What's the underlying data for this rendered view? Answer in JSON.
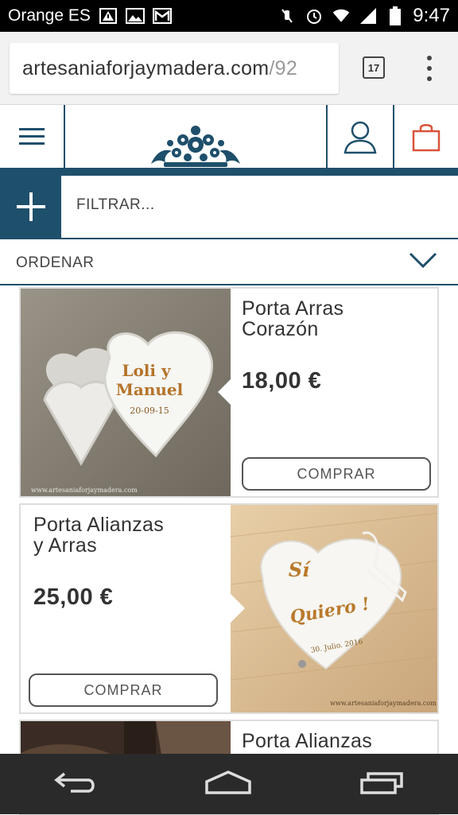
{
  "statusbar": {
    "carrier": "Orange ES",
    "time": "9:47",
    "icons": [
      "warning-icon",
      "image-icon",
      "gmail-icon",
      "mute-icon",
      "alarm-icon",
      "wifi-icon",
      "signal-icon",
      "battery-icon"
    ]
  },
  "browser": {
    "url_main": "artesaniaforjaymadera.com",
    "url_rest": "/92",
    "tab_count": "17"
  },
  "site": {
    "colors": {
      "accent": "#1e4f6b",
      "cart": "#d9523a"
    }
  },
  "filter": {
    "label": "FILTRAR..."
  },
  "sort": {
    "label": "ORDENAR"
  },
  "products": [
    {
      "title_line1": "Porta Arras",
      "title_line2": "Corazón",
      "price": "18,00 €",
      "buy_label": "COMPRAR",
      "image_text": [
        "Loli y",
        "Manuel",
        "20-09-15"
      ],
      "watermark": "www.artesaniaforjaymadera.com"
    },
    {
      "title_line1": "Porta Alianzas",
      "title_line2": "y Arras",
      "price": "25,00 €",
      "buy_label": "COMPRAR",
      "image_text": [
        "Sí",
        "Quiero !",
        "30. Julio. 2016"
      ],
      "watermark": "www.artesaniaforjaymadera.com"
    },
    {
      "title_line1": "Porta Alianzas"
    }
  ]
}
